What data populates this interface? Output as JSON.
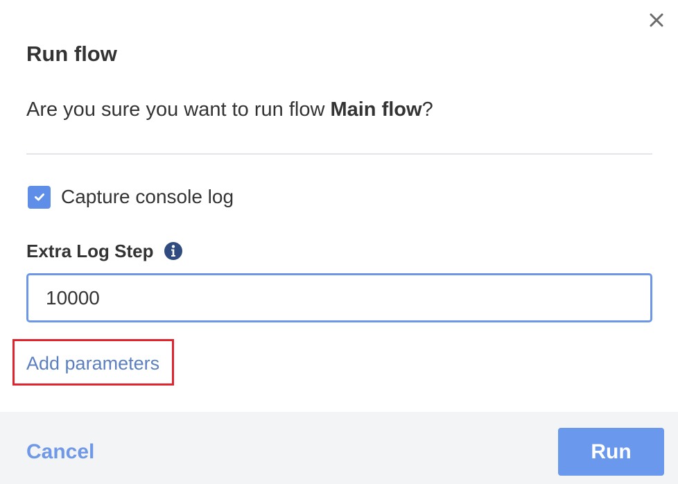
{
  "dialog": {
    "title": "Run flow",
    "question_prefix": "Are you sure you want to run flow ",
    "flow_name": "Main flow",
    "question_suffix": "?"
  },
  "options": {
    "capture_console_log": {
      "label": "Capture console log",
      "checked": true
    }
  },
  "extra_log_step": {
    "label": "Extra Log Step",
    "value": "10000"
  },
  "add_parameters": {
    "label": "Add parameters",
    "highlight_color": "#e0232d"
  },
  "footer": {
    "cancel_label": "Cancel",
    "run_label": "Run"
  },
  "colors": {
    "accent": "#6a98ed",
    "link": "#5b7fbf",
    "checkbox": "#5e8ee8",
    "footer_bg": "#f3f4f6"
  },
  "icons": {
    "close": "close-icon",
    "check": "check-icon",
    "info": "info-icon"
  }
}
